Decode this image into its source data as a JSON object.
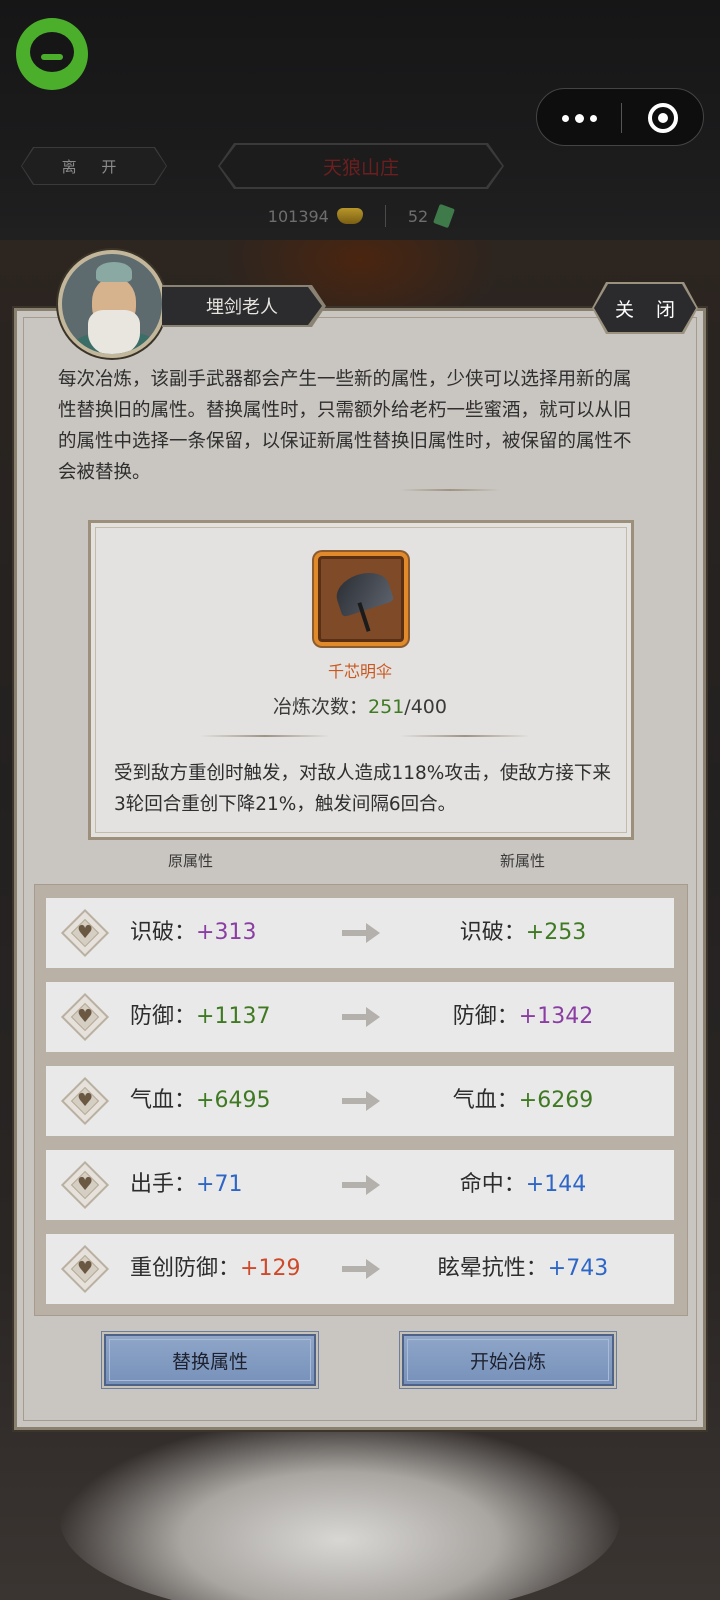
{
  "topbar": {
    "leave_label": "离 开",
    "location_title": "天狼山庄",
    "gold_amount": "101394",
    "ticket_amount": "52"
  },
  "dialog": {
    "npc_name": "埋剑老人",
    "close_label": "关 闭",
    "intro": "每次冶炼，该副手武器都会产生一些新的属性，少侠可以选择用新的属性替换旧的属性。替换属性时，只需额外给老朽一些蜜酒，就可以从旧的属性中选择一条保留，以保证新属性替换旧属性时，被保留的属性不会被替换。"
  },
  "item": {
    "name": "千芯明伞",
    "smelt_label": "冶炼次数：",
    "smelt_current": "251",
    "smelt_max": "/400",
    "effect": "受到敌方重创时触发，对敌人造成118%攻击，使敌方接下来3轮回合重创下降21%，触发间隔6回合。"
  },
  "columns": {
    "old_label": "原属性",
    "new_label": "新属性"
  },
  "attributes": [
    {
      "old_name": "识破：",
      "old_value": "+313",
      "new_name": "识破：",
      "new_value": "+253"
    },
    {
      "old_name": "防御：",
      "old_value": "+1137",
      "new_name": "防御：",
      "new_value": "+1342"
    },
    {
      "old_name": "气血：",
      "old_value": "+6495",
      "new_name": "气血：",
      "new_value": "+6269"
    },
    {
      "old_name": "出手：",
      "old_value": "+71",
      "new_name": "命中：",
      "new_value": "+144"
    },
    {
      "old_name": "重创防御：",
      "old_value": "+129",
      "new_name": "眩晕抗性：",
      "new_value": "+743"
    }
  ],
  "actions": {
    "replace_label": "替换属性",
    "start_label": "开始冶炼"
  },
  "colors": {
    "purple": "#8a3ea3",
    "green": "#3f7a23",
    "blue": "#2e66c7",
    "red": "#cf4a2b",
    "item_name": "#c9581f"
  }
}
